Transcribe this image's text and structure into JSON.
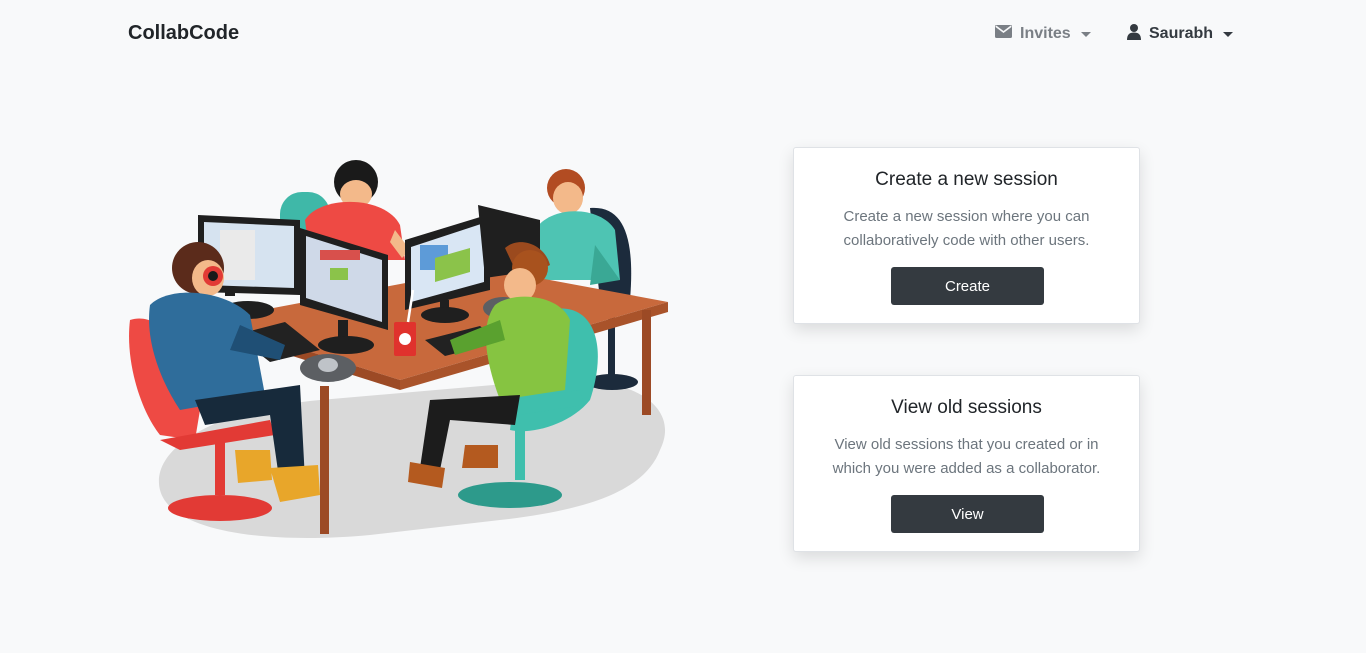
{
  "navbar": {
    "brand": "CollabCode",
    "invites_label": "Invites",
    "user_label": "Saurabh"
  },
  "illustration": {
    "subject": "team-coding-at-desk"
  },
  "cards": {
    "create": {
      "title": "Create a new session",
      "text": "Create a new session where you can collaboratively code with other users.",
      "button_label": "Create"
    },
    "view": {
      "title": "View old sessions",
      "text": "View old sessions that you created or in which you were added as a collaborator.",
      "button_label": "View"
    }
  },
  "colors": {
    "page_bg": "#f8f9fa",
    "button_bg": "#343a40",
    "text_muted": "#6c757d"
  }
}
